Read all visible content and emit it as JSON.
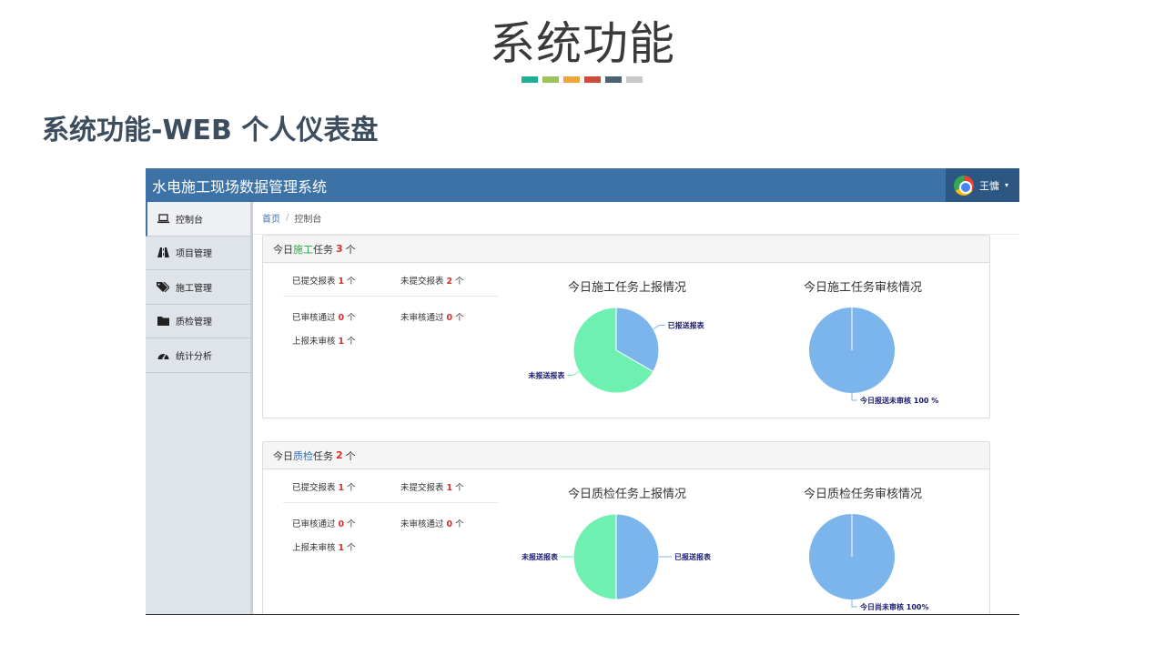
{
  "slide": {
    "title": "系统功能",
    "subtitle": "系统功能-WEB 个人仪表盘",
    "bar_colors": [
      "#1fae96",
      "#9dc35a",
      "#eea53a",
      "#cf4c3c",
      "#4b6275",
      "#c8c8c8"
    ]
  },
  "app": {
    "title": "水电施工现场数据管理系统",
    "user_name": "王慵",
    "caret": "▾"
  },
  "sidebar": {
    "items": [
      {
        "label": "控制台",
        "icon": "laptop-icon"
      },
      {
        "label": "项目管理",
        "icon": "road-icon"
      },
      {
        "label": "施工管理",
        "icon": "tags-icon"
      },
      {
        "label": "质检管理",
        "icon": "folder-icon"
      },
      {
        "label": "统计分析",
        "icon": "dashboard-icon"
      }
    ]
  },
  "breadcrumb": {
    "home": "首页",
    "sep": "/",
    "current": "控制台"
  },
  "panels": [
    {
      "head_prefix": "今日",
      "head_keyword": "施工",
      "head_suffix": "任务",
      "count": "3",
      "unit": "个",
      "stats": {
        "submitted_label": "已提交报表",
        "submitted": "1",
        "not_submitted_label": "未提交报表",
        "not_submitted": "2",
        "approved_label": "已审核通过",
        "approved": "0",
        "not_approved_label": "未审核通过",
        "not_approved": "0",
        "pending_label": "上报未审核",
        "pending": "1",
        "unit": "个"
      },
      "chart1_title": "今日施工任务上报情况",
      "chart2_title": "今日施工任务审核情况"
    },
    {
      "head_prefix": "今日",
      "head_keyword": "质检",
      "head_suffix": "任务",
      "count": "2",
      "unit": "个",
      "stats": {
        "submitted_label": "已提交报表",
        "submitted": "1",
        "not_submitted_label": "未提交报表",
        "not_submitted": "1",
        "approved_label": "已审核通过",
        "approved": "0",
        "not_approved_label": "未审核通过",
        "not_approved": "0",
        "pending_label": "上报未审核",
        "pending": "1",
        "unit": "个"
      },
      "chart1_title": "今日质检任务上报情况",
      "chart2_title": "今日质检任务审核情况"
    }
  ],
  "chart_data": [
    {
      "type": "pie",
      "title": "今日施工任务上报情况",
      "slices": [
        {
          "label": "已报送报表",
          "value": 1,
          "color": "#7cb5ec"
        },
        {
          "label": "未报送报表",
          "value": 2,
          "color": "#6ef0b0"
        }
      ]
    },
    {
      "type": "pie",
      "title": "今日施工任务审核情况",
      "slices": [
        {
          "label": "今日报送未审核 100 %",
          "value": 100,
          "color": "#7cb5ec"
        }
      ]
    },
    {
      "type": "pie",
      "title": "今日质检任务上报情况",
      "slices": [
        {
          "label": "已报送报表",
          "value": 1,
          "color": "#7cb5ec"
        },
        {
          "label": "未报送报表",
          "value": 1,
          "color": "#6ef0b0"
        }
      ]
    },
    {
      "type": "pie",
      "title": "今日质检任务审核情况",
      "slices": [
        {
          "label": "今日尚未审核 100%",
          "value": 100,
          "color": "#7cb5ec"
        }
      ]
    }
  ]
}
